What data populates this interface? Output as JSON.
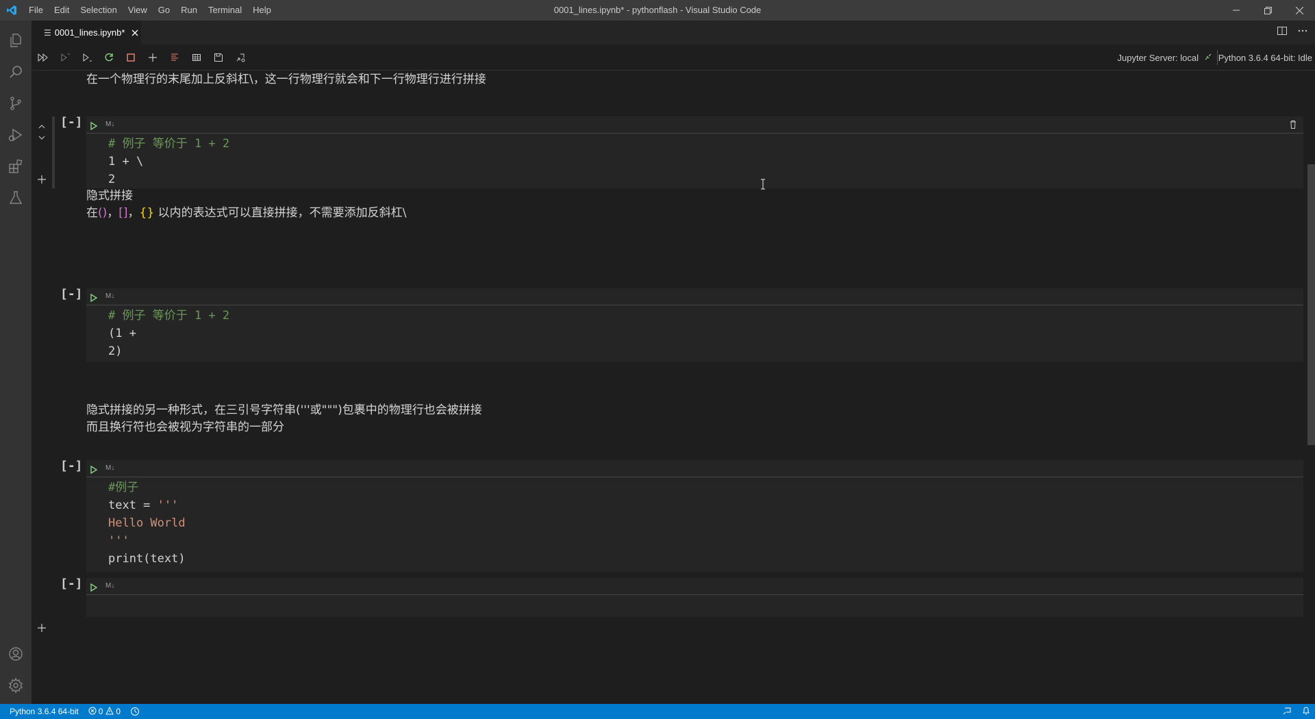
{
  "window": {
    "title": "0001_lines.ipynb* - pythonflash - Visual Studio Code",
    "menu": [
      "File",
      "Edit",
      "Selection",
      "View",
      "Go",
      "Run",
      "Terminal",
      "Help"
    ]
  },
  "tab": {
    "label": "0001_lines.ipynb*"
  },
  "toolbar": {
    "buttons": [
      "run-all",
      "run-above",
      "run-below",
      "restart-kernel",
      "interrupt-kernel",
      "add-cell",
      "variables",
      "data-viewer",
      "save",
      "export"
    ],
    "jupyter_server": "Jupyter Server: local",
    "kernel": "Python 3.6.4 64-bit: Idle"
  },
  "cells": [
    {
      "type": "markdown",
      "lines": [
        "在一个物理行的末尾加上反斜杠\\，这一行物理行就会和下一行物理行进行拼接"
      ]
    },
    {
      "type": "code",
      "prompt": "[-]",
      "badge": "M↓",
      "lines": [
        [
          {
            "t": "# 例子 等价于 1 + 2",
            "c": "comment"
          }
        ],
        [
          {
            "t": "1 + \\",
            "c": "plain"
          }
        ],
        [
          {
            "t": "2",
            "c": "plain"
          }
        ]
      ]
    },
    {
      "type": "markdown",
      "lines": [
        "隐式拼接"
      ],
      "rich_line": [
        {
          "t": "在",
          "c": "plain"
        },
        {
          "t": "()",
          "c": "brace"
        },
        {
          "t": "，",
          "c": "plain"
        },
        {
          "t": "[]",
          "c": "brace"
        },
        {
          "t": "，",
          "c": "plain"
        },
        {
          "t": "{}",
          "c": "bracket"
        },
        {
          "t": " 以内的表达式可以直接拼接，不需要添加反斜杠\\",
          "c": "plain"
        }
      ]
    },
    {
      "type": "code",
      "prompt": "[-]",
      "badge": "M↓",
      "lines": [
        [
          {
            "t": "# 例子 等价于 1 + 2",
            "c": "comment"
          }
        ],
        [
          {
            "t": "(1 +",
            "c": "plain"
          }
        ],
        [
          {
            "t": "2)",
            "c": "plain"
          }
        ]
      ]
    },
    {
      "type": "markdown",
      "lines": [
        "隐式拼接的另一种形式，在三引号字符串('''或\"\"\")包裹中的物理行也会被拼接",
        "而且换行符也会被视为字符串的一部分"
      ]
    },
    {
      "type": "code",
      "prompt": "[-]",
      "badge": "M↓",
      "lines": [
        [
          {
            "t": "#例子",
            "c": "comment"
          }
        ],
        [
          {
            "t": "text = ",
            "c": "plain"
          },
          {
            "t": "'''",
            "c": "string"
          }
        ],
        [
          {
            "t": "Hello World",
            "c": "string"
          }
        ],
        [
          {
            "t": "'''",
            "c": "string"
          }
        ],
        [
          {
            "t": "print(text)",
            "c": "plain"
          }
        ]
      ]
    },
    {
      "type": "code",
      "prompt": "[-]",
      "badge": "M↓",
      "lines": []
    }
  ],
  "statusbar": {
    "interpreter": "Python 3.6.4 64-bit",
    "errors": "0",
    "warnings": "0"
  },
  "colors": {
    "statusbar": "#007acc",
    "comment": "#6a9955",
    "string": "#ce9178",
    "run_green": "#89d185",
    "stop_red": "#f48771"
  }
}
